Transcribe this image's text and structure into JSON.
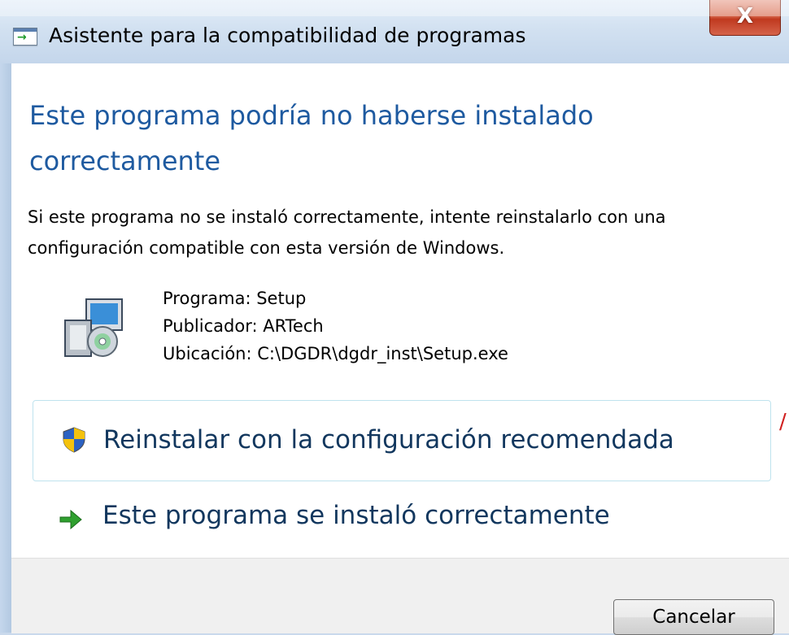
{
  "window": {
    "title": "Asistente para la compatibilidad de programas",
    "close_label": "X"
  },
  "main": {
    "heading": "Este programa podría no haberse instalado correctamente",
    "description": "Si este programa no se instaló correctamente, intente reinstalarlo con una configuración compatible con esta versión de Windows.",
    "program": {
      "name_line": "Programa: Setup",
      "publisher_line": "Publicador: ARTech",
      "location_line": "Ubicación: C:\\DGDR\\dgdr_inst\\Setup.exe"
    },
    "options": [
      {
        "label": "Reinstalar con la configuración recomendada",
        "icon": "uac-shield-icon"
      },
      {
        "label": "Este programa se instaló correctamente",
        "icon": "green-arrow-icon"
      }
    ]
  },
  "footer": {
    "cancel_label": "Cancelar"
  },
  "colors": {
    "heading": "#1e5aa0",
    "command_text": "#12375e",
    "close_button": "#c0391f"
  }
}
